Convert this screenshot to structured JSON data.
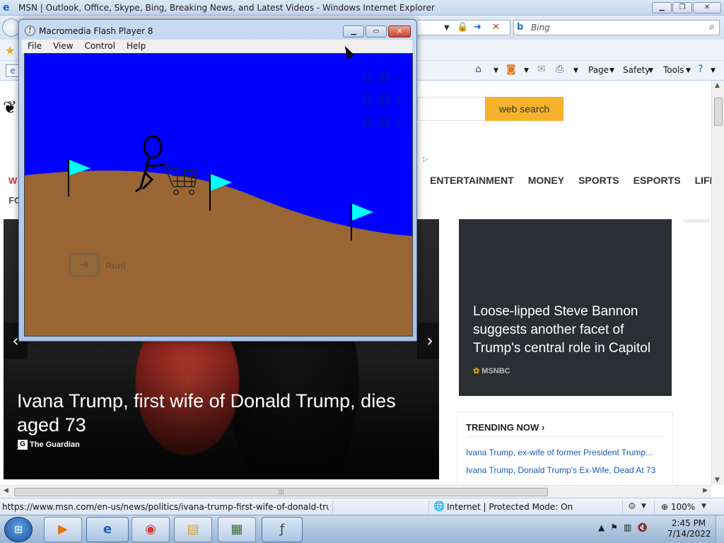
{
  "ie": {
    "title": "MSN | Outlook, Office, Skype, Bing, Breaking News, and Latest Videos - Windows Internet Explorer",
    "search_placeholder": "Bing",
    "commands": [
      "Page",
      "Safety",
      "Tools"
    ]
  },
  "msn": {
    "search_button": "web search",
    "nav_categories": [
      "ENTERTAINMENT",
      "MONEY",
      "SPORTS",
      "ESPORTS",
      "LIFESTYLE"
    ],
    "nav_left_1": "W",
    "nav_left_2": "FO",
    "hero": {
      "title": "Ivana Trump, first wife of Donald Trump, dies aged 73",
      "source": "The Guardian",
      "source_badge": "G"
    },
    "side_card": {
      "headline": "Loose-lipped Steve Bannon suggests another facet of Trump's central role in Capitol",
      "source": "MSNBC"
    },
    "trending": {
      "header": "TRENDING NOW ›",
      "items": [
        "Ivana Trump, ex-wife of former President Trump...",
        "Ivana Trump, Donald Trump's Ex-Wife, Dead At 73"
      ]
    }
  },
  "status": {
    "url": "https://www.msn.com/en-us/news/politics/ivana-trump-first-wife-of-donald-trump-d",
    "zone": "Internet | Protected Mode: On",
    "zoom": "100%"
  },
  "flash": {
    "title": "Macromedia Flash Player 8",
    "menu": [
      "File",
      "View",
      "Control",
      "Help"
    ],
    "readouts": [
      "0.0",
      "0.0",
      "0.0"
    ],
    "run_label": "Run!",
    "colors": {
      "sky": "#0000ff",
      "ground": "#996633",
      "flag": "#00ffff"
    }
  },
  "taskbar": {
    "time": "2:45 PM",
    "date": "7/14/2022"
  }
}
